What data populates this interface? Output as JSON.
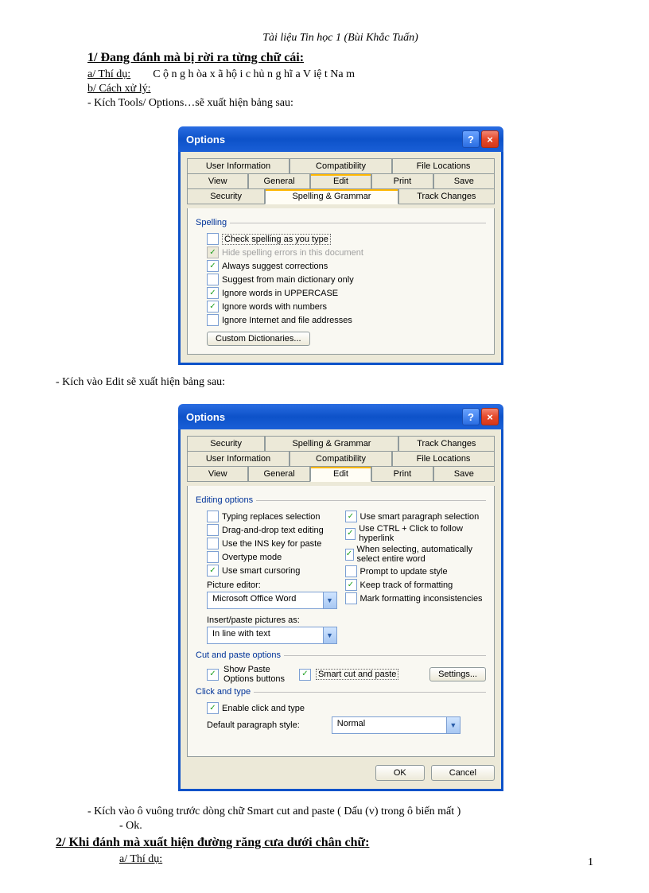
{
  "doc": {
    "header": "Tài liệu Tin học 1 (Bùi Khắc Tuấn)",
    "s1_title": "1/ Đang đánh mà bị rời ra từng chữ  cái:",
    "s1_a": "a/ Thí dụ:",
    "s1_a_ex": "C ộ n g h òa x ã hộ i c hủ n g hĩ a V iệ t Na m",
    "s1_b": "b/ Cách xử lý:",
    "s1_b1": "- Kích Tools/ Options…sẽ xuất hiện bảng  sau:",
    "s1_c": "- Kích vào Edit sẽ xuất hiện bảng sau:",
    "s1_d": "- Kích vào ô vuông trước dòng chữ Smart cut and paste ( Dấu (v) trong ô biến mất )",
    "s1_e": "- Ok.",
    "s2_title": "2/ Khi đánh mà xuất hiện đường răng cưa dưới chân chữ:",
    "s2_a": "a/ Thí dụ:",
    "page_num": "1"
  },
  "dlg1": {
    "title": "Options",
    "tabs_r1": [
      "User Information",
      "Compatibility",
      "File Locations"
    ],
    "tabs_r2": [
      "View",
      "General",
      "Edit",
      "Print",
      "Save"
    ],
    "tabs_r3": [
      "Security",
      "Spelling & Grammar",
      "Track Changes"
    ],
    "section": "Spelling",
    "opt1": "Check spelling as you type",
    "opt2": "Hide spelling errors in this document",
    "opt3": "Always suggest corrections",
    "opt4": "Suggest from main dictionary only",
    "opt5": "Ignore words in UPPERCASE",
    "opt6": "Ignore words with numbers",
    "opt7": "Ignore Internet and file addresses",
    "btn_custom": "Custom Dictionaries..."
  },
  "dlg2": {
    "title": "Options",
    "tabs_r1": [
      "Security",
      "Spelling & Grammar",
      "Track Changes"
    ],
    "tabs_r2": [
      "User Information",
      "Compatibility",
      "File Locations"
    ],
    "tabs_r3": [
      "View",
      "General",
      "Edit",
      "Print",
      "Save"
    ],
    "section_edit": "Editing options",
    "e1": "Typing replaces selection",
    "e2": "Drag-and-drop text editing",
    "e3": "Use the INS key for paste",
    "e4": "Overtype mode",
    "e5": "Use smart cursoring",
    "pic_lbl": "Picture editor:",
    "pic_val": "Microsoft Office Word",
    "ins_lbl": "Insert/paste pictures as:",
    "ins_val": "In line with text",
    "r1": "Use smart paragraph selection",
    "r2": "Use CTRL + Click to follow hyperlink",
    "r3": "When selecting, automatically select entire word",
    "r4": "Prompt to update style",
    "r5": "Keep track of formatting",
    "r6": "Mark formatting inconsistencies",
    "section_cut": "Cut and paste options",
    "cp1": "Show Paste Options buttons",
    "cp2": "Smart cut and paste",
    "btn_settings": "Settings...",
    "section_click": "Click and type",
    "ct1": "Enable click and type",
    "ct_lbl": "Default paragraph style:",
    "ct_val": "Normal",
    "btn_ok": "OK",
    "btn_cancel": "Cancel"
  }
}
